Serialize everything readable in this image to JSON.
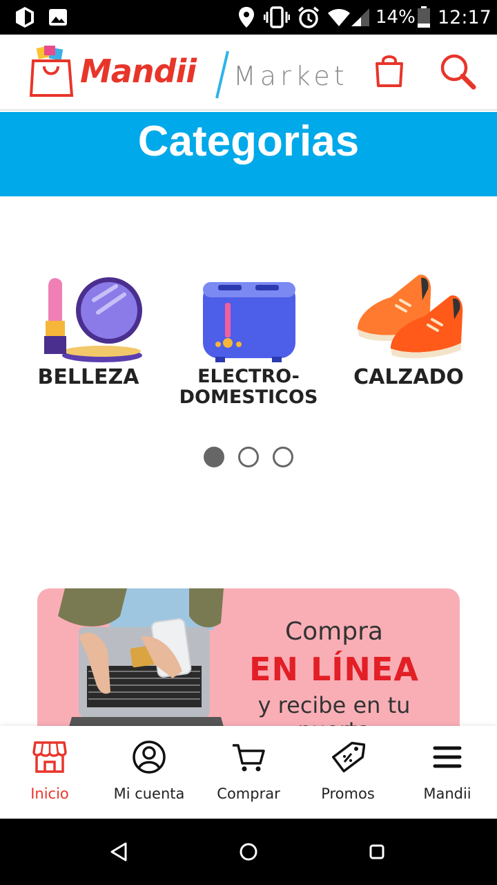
{
  "status_bar": {
    "battery": "14%",
    "time": "12:17"
  },
  "header": {
    "brand_main": "Mandii",
    "brand_sub": "Market",
    "icons": [
      "shopping-bag-icon",
      "search-icon"
    ],
    "accent_color": "#e8352a"
  },
  "banner": {
    "title": "Categorias",
    "color": "#00a9e9"
  },
  "categories": [
    {
      "label": "BELLEZA",
      "icon": "lipstick-mirror-icon"
    },
    {
      "label_line1": "ELECTRO-",
      "label_line2": "DOMESTICOS",
      "icon": "toaster-icon"
    },
    {
      "label": "CALZADO",
      "icon": "sneakers-icon"
    }
  ],
  "carousel": {
    "pages": 3,
    "active_page": 1
  },
  "promo": {
    "line1": "Compra",
    "line2": "EN LÍNEA",
    "line3": "y recibe en tu",
    "line4": "puerta"
  },
  "bottom_nav": {
    "items": [
      {
        "label": "Inicio",
        "icon": "store-icon",
        "active": true
      },
      {
        "label": "Mi cuenta",
        "icon": "user-icon",
        "active": false
      },
      {
        "label": "Comprar",
        "icon": "cart-icon",
        "active": false
      },
      {
        "label": "Promos",
        "icon": "tag-icon",
        "active": false
      },
      {
        "label": "Mandii",
        "icon": "menu-icon",
        "active": false
      }
    ]
  }
}
